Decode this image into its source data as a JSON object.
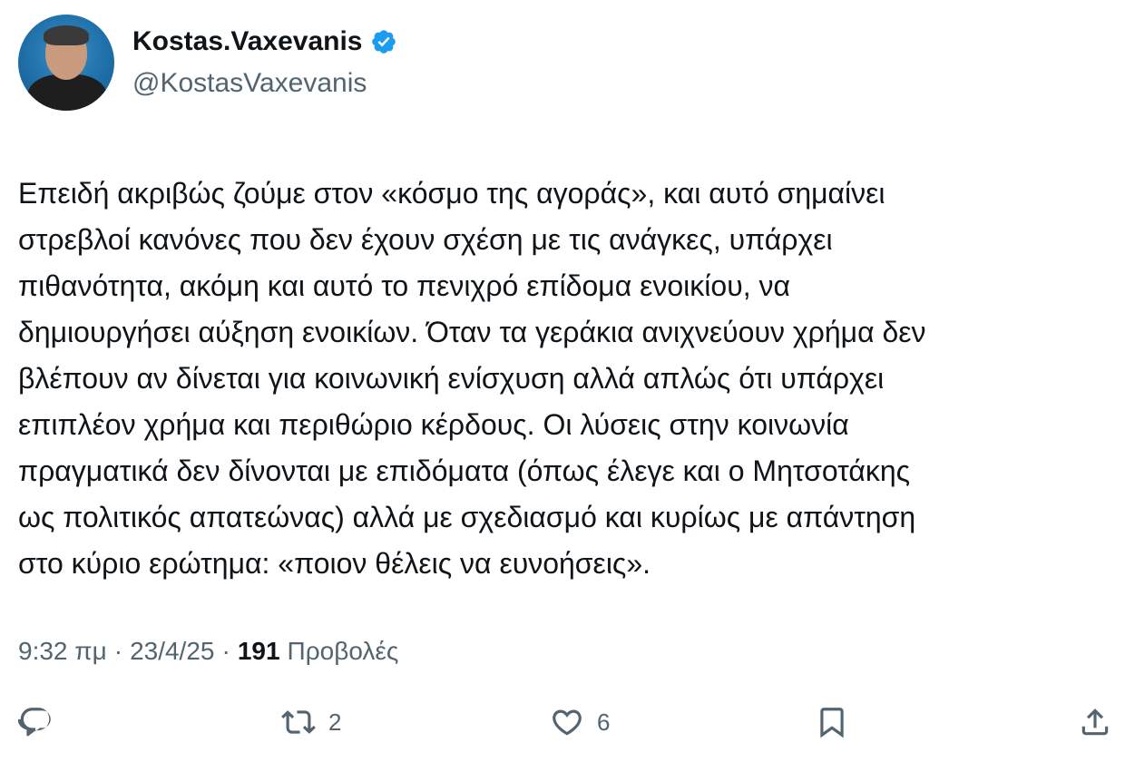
{
  "user": {
    "display_name": "Kostas.Vaxevanis",
    "handle": "@KostasVaxevanis",
    "verified": true
  },
  "tweet": {
    "lines": [
      "Επειδή ακριβώς ζούμε στον «κόσμο της αγοράς», και αυτό σημαίνει",
      "στρεβλοί κανόνες που δεν έχουν σχέση με τις ανάγκες, υπάρχει",
      "πιθανότητα, ακόμη και αυτό το πενιχρό επίδομα ενοικίου, να",
      "δημιουργήσει αύξηση ενοικίων. Όταν τα γεράκια ανιχνεύουν χρήμα δεν",
      "βλέπουν αν δίνεται για κοινωνική ενίσχυση αλλά απλώς ότι υπάρχει",
      "επιπλέον χρήμα και περιθώριο κέρδους. Οι λύσεις στην κοινωνία",
      "πραγματικά δεν δίνονται με επιδόματα (όπως έλεγε και ο Μητσοτάκης",
      "ως πολιτικός απατεώνας) αλλά με σχεδιασμό και κυρίως με απάντηση",
      "στο κύριο ερώτημα: «ποιον θέλεις να ευνοήσεις»."
    ]
  },
  "meta": {
    "time": "9:32 πμ",
    "separator": "·",
    "date": "23/4/25",
    "views_count": "191",
    "views_label": "Προβολές"
  },
  "actions": {
    "reply_icon": "reply-icon",
    "retweet_icon": "retweet-icon",
    "retweet_count": "2",
    "like_icon": "heart-icon",
    "like_count": "6",
    "bookmark_icon": "bookmark-icon",
    "share_icon": "share-icon"
  },
  "colors": {
    "text": "#0f1419",
    "secondary": "#536471",
    "verified": "#1d9bf0"
  }
}
